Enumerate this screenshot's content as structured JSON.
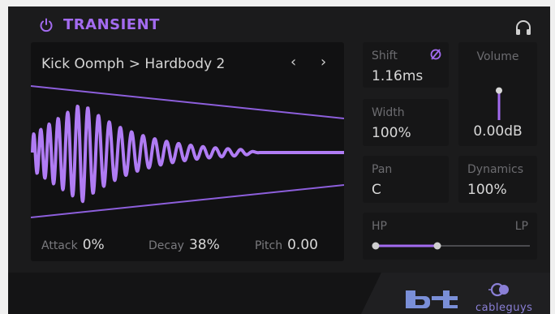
{
  "plugin": {
    "title": "TRANSIENT",
    "accent": "#a36bf0"
  },
  "icons": {
    "power": "power-icon",
    "headphones": "headphones-icon",
    "phase": "phase-invert-icon",
    "nav_prev": "‹",
    "nav_next": "›"
  },
  "preset": {
    "name": "Kick Oomph > Hardbody 2"
  },
  "envelope": {
    "attack_label": "Attack",
    "attack_value": "0%",
    "decay_label": "Decay",
    "decay_value": "38%",
    "pitch_label": "Pitch",
    "pitch_value": "0.00"
  },
  "controls": {
    "shift_label": "Shift",
    "shift_value": "1.16ms",
    "width_label": "Width",
    "width_value": "100%",
    "pan_label": "Pan",
    "pan_value": "C",
    "volume_label": "Volume",
    "volume_value": "0.00dB",
    "volume_level": 0.6,
    "dynamics_label": "Dynamics",
    "dynamics_value": "100%",
    "hp_label": "HP",
    "lp_label": "LP",
    "hp_position": 0.0,
    "lp_position": 0.4
  },
  "branding": {
    "bt_logo": "bt",
    "cableguys_text": "cableguys"
  }
}
